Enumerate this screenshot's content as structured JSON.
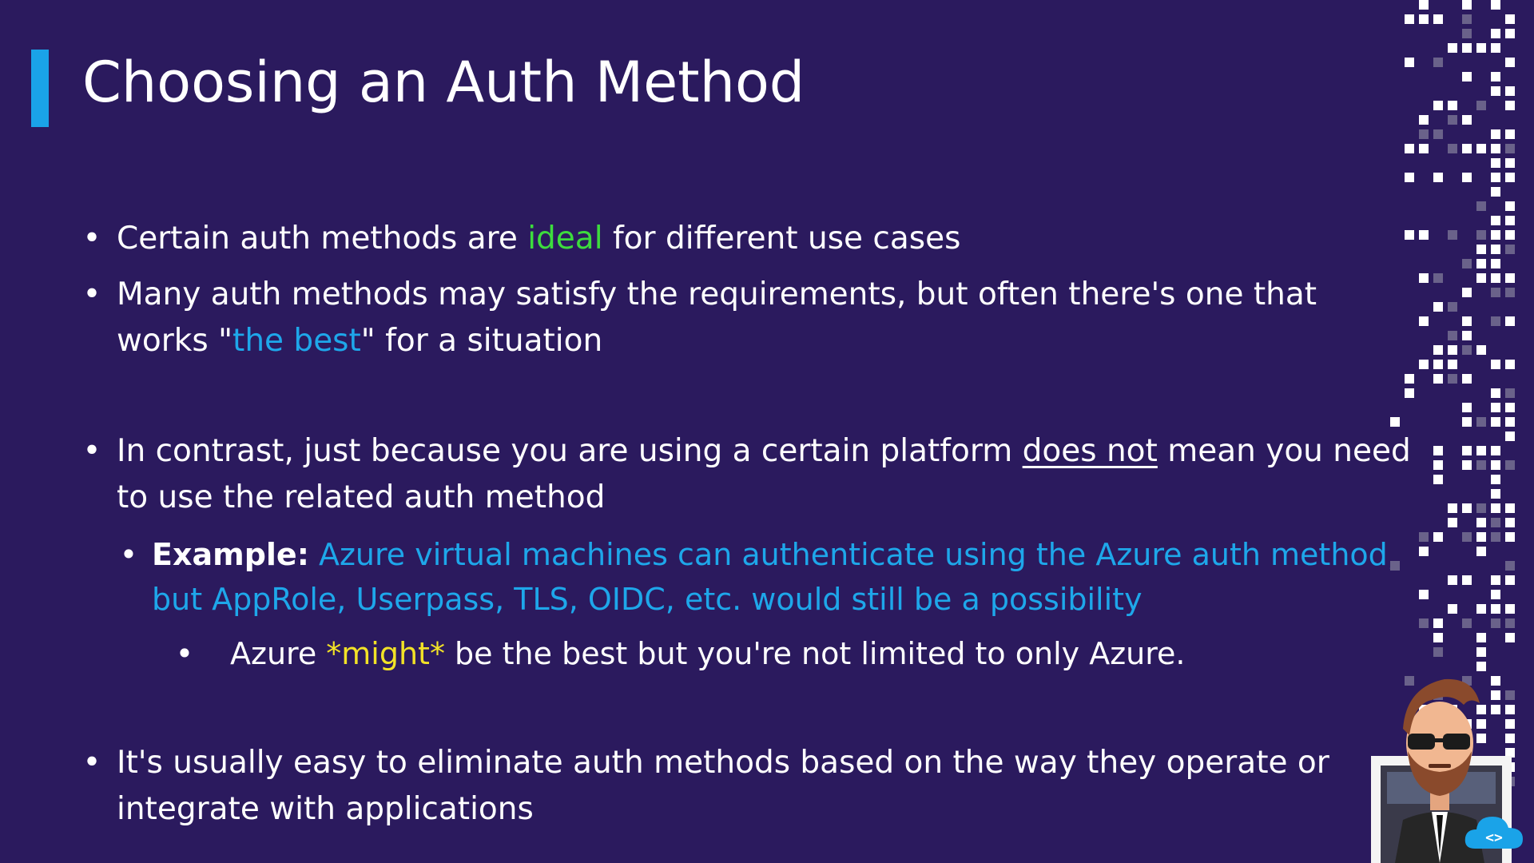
{
  "slide": {
    "title": "Choosing an Auth Method",
    "accent_color": "#1aa3e8",
    "background_color": "#2b1a5e",
    "bullets": [
      {
        "parts": [
          "Certain auth methods are ",
          "ideal",
          " for different use cases"
        ]
      },
      {
        "line1": "Many auth methods may satisfy the requirements, but often there's one that",
        "line2_parts": [
          "works \"",
          "the best",
          "\" for a situation"
        ]
      },
      {
        "line1_parts": [
          "In contrast, just because you are using a certain platform ",
          "does not",
          " mean you need"
        ],
        "line2": "to use the related auth method"
      },
      {
        "label": "Example:",
        "line1": " Azure virtual machines can authenticate using the Azure auth method,",
        "line2": "but AppRole, Userpass, TLS, OIDC, etc. would still be a possibility"
      },
      {
        "parts": [
          "Azure ",
          "*might*",
          " be the best but you're not limited to only Azure."
        ]
      },
      {
        "line1": "It's usually easy to eliminate auth methods based on the way they operate or",
        "line2": "integrate with applications"
      }
    ],
    "bullet_glyph": "•",
    "highlight_colors": {
      "green": "#3ddc3d",
      "blue": "#1ea7ea",
      "yellow": "#f2e227"
    },
    "icons": [
      "pixel-pattern-decoration",
      "instructor-avatar-icon",
      "cloud-code-logo-icon"
    ]
  }
}
